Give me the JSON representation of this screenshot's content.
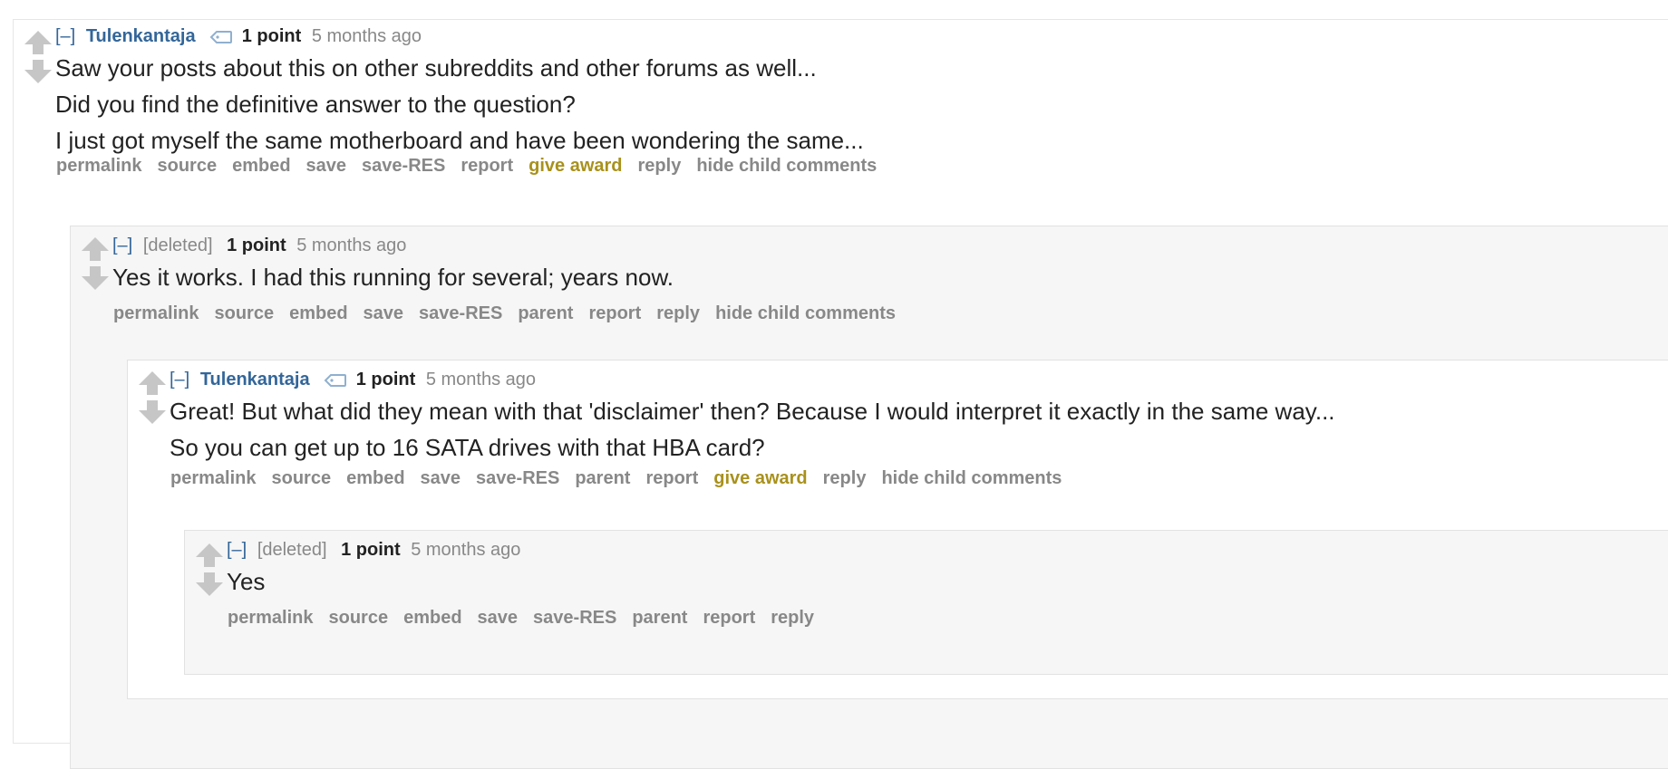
{
  "comments": [
    {
      "expand": "[–]",
      "author": "Tulenkantaja",
      "score": "1 point",
      "time": "5 months ago",
      "body": [
        "Saw your posts about this on other subreddits and other forums as well...",
        "Did you find the definitive answer to the question?",
        "I just got myself the same motherboard and have been wondering the same..."
      ],
      "buttons": [
        "permalink",
        "source",
        "embed",
        "save",
        "save-RES",
        "report",
        "give award",
        "reply",
        "hide child comments"
      ]
    },
    {
      "expand": "[–]",
      "author": "[deleted]",
      "score": "1 point",
      "time": "5 months ago",
      "body": [
        "Yes it works. I had this running for several; years now."
      ],
      "buttons": [
        "permalink",
        "source",
        "embed",
        "save",
        "save-RES",
        "parent",
        "report",
        "reply",
        "hide child comments"
      ]
    },
    {
      "expand": "[–]",
      "author": "Tulenkantaja",
      "score": "1 point",
      "time": "5 months ago",
      "body": [
        "Great! But what did they mean with that 'disclaimer' then? Because I would interpret it exactly in the same way...",
        "So you can get up to 16 SATA drives with that HBA card?"
      ],
      "buttons": [
        "permalink",
        "source",
        "embed",
        "save",
        "save-RES",
        "parent",
        "report",
        "give award",
        "reply",
        "hide child comments"
      ]
    },
    {
      "expand": "[–]",
      "author": "[deleted]",
      "score": "1 point",
      "time": "5 months ago",
      "body": [
        "Yes"
      ],
      "buttons": [
        "permalink",
        "source",
        "embed",
        "save",
        "save-RES",
        "parent",
        "report",
        "reply"
      ]
    }
  ],
  "colors": {
    "author": "#336699",
    "award": "#a8911c",
    "meta": "#888888",
    "text": "#222222",
    "arrow": "#c6c6c6"
  },
  "icons": {
    "upvote": "upvote-arrow-icon",
    "downvote": "downvote-arrow-icon",
    "flair": "tag-icon"
  }
}
